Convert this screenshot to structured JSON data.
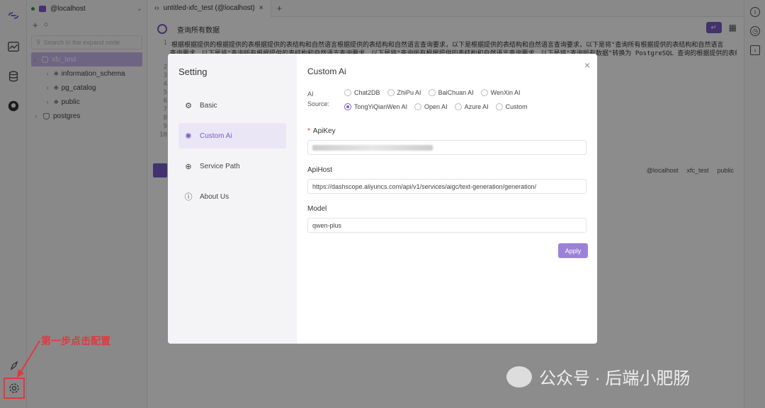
{
  "tree": {
    "connection": "@localhost",
    "search_placeholder": "Search in the expand node",
    "items": [
      {
        "label": "xfc_test",
        "type": "db",
        "selected": true
      },
      {
        "label": "information_schema",
        "type": "schema"
      },
      {
        "label": "pg_catalog",
        "type": "schema"
      },
      {
        "label": "public",
        "type": "schema"
      },
      {
        "label": "postgres",
        "type": "db"
      }
    ]
  },
  "tabs": {
    "active": "untitled-xfc_test (@localhost)",
    "close": "×",
    "add": "+"
  },
  "toolbar": {
    "query_label": "查询所有数据"
  },
  "editor": {
    "line1": "根据根据提供的根据提供的表根据提供的表结构和自然语言根据提供的表结构和自然语言查询要求，以下是根据提供的表结构和自然语言查询要求，以下是将\"查询所有根据提供的表结构和自然语言",
    "line2": "查询要求，以下是将\"查询所有根据提供的表结构和自然语言查询要求，以下是将\"查询所有根据提供的表结构和自然语言查询要求，以下是将\"查询所有数据\"转换为 PostgreSQL 查询的根据提供的表结构和自然语言查询要求，以下是将\"查",
    "line_numbers": [
      "1",
      "2",
      "3",
      "4",
      "5",
      "6",
      "7",
      "8",
      "9",
      "10"
    ]
  },
  "status": {
    "connection": "@localhost",
    "database": "xfc_test",
    "schema": "public"
  },
  "modal": {
    "title": "Setting",
    "nav": [
      {
        "label": "Basic",
        "icon": "gear-icon"
      },
      {
        "label": "Custom Ai",
        "icon": "ai-icon",
        "active": true
      },
      {
        "label": "Service Path",
        "icon": "globe-icon"
      },
      {
        "label": "About Us",
        "icon": "info-icon"
      }
    ],
    "section_title": "Custom Ai",
    "ai_source_label_1": "AI",
    "ai_source_label_2": "Source:",
    "ai_sources": [
      {
        "label": "Chat2DB",
        "checked": false
      },
      {
        "label": "ZhiPu AI",
        "checked": false
      },
      {
        "label": "BaiChuan AI",
        "checked": false
      },
      {
        "label": "WenXin AI",
        "checked": false
      },
      {
        "label": "TongYiQianWen AI",
        "checked": true
      },
      {
        "label": "Open AI",
        "checked": false
      },
      {
        "label": "Azure AI",
        "checked": false
      },
      {
        "label": "Custom",
        "checked": false
      }
    ],
    "api_key_label": "ApiKey",
    "required_mark": "*",
    "api_host_label": "ApiHost",
    "api_host_value": "https://dashscope.aliyuncs.com/api/v1/services/aigc/text-generation/generation/",
    "model_label": "Model",
    "model_value": "qwen-plus",
    "apply_label": "Apply",
    "close": "×"
  },
  "annotation": {
    "text": "第一步点击配置",
    "color": "#e0393e"
  },
  "watermark": {
    "text": "公众号 · 后端小肥肠"
  },
  "colors": {
    "accent": "#7a5cc8"
  }
}
